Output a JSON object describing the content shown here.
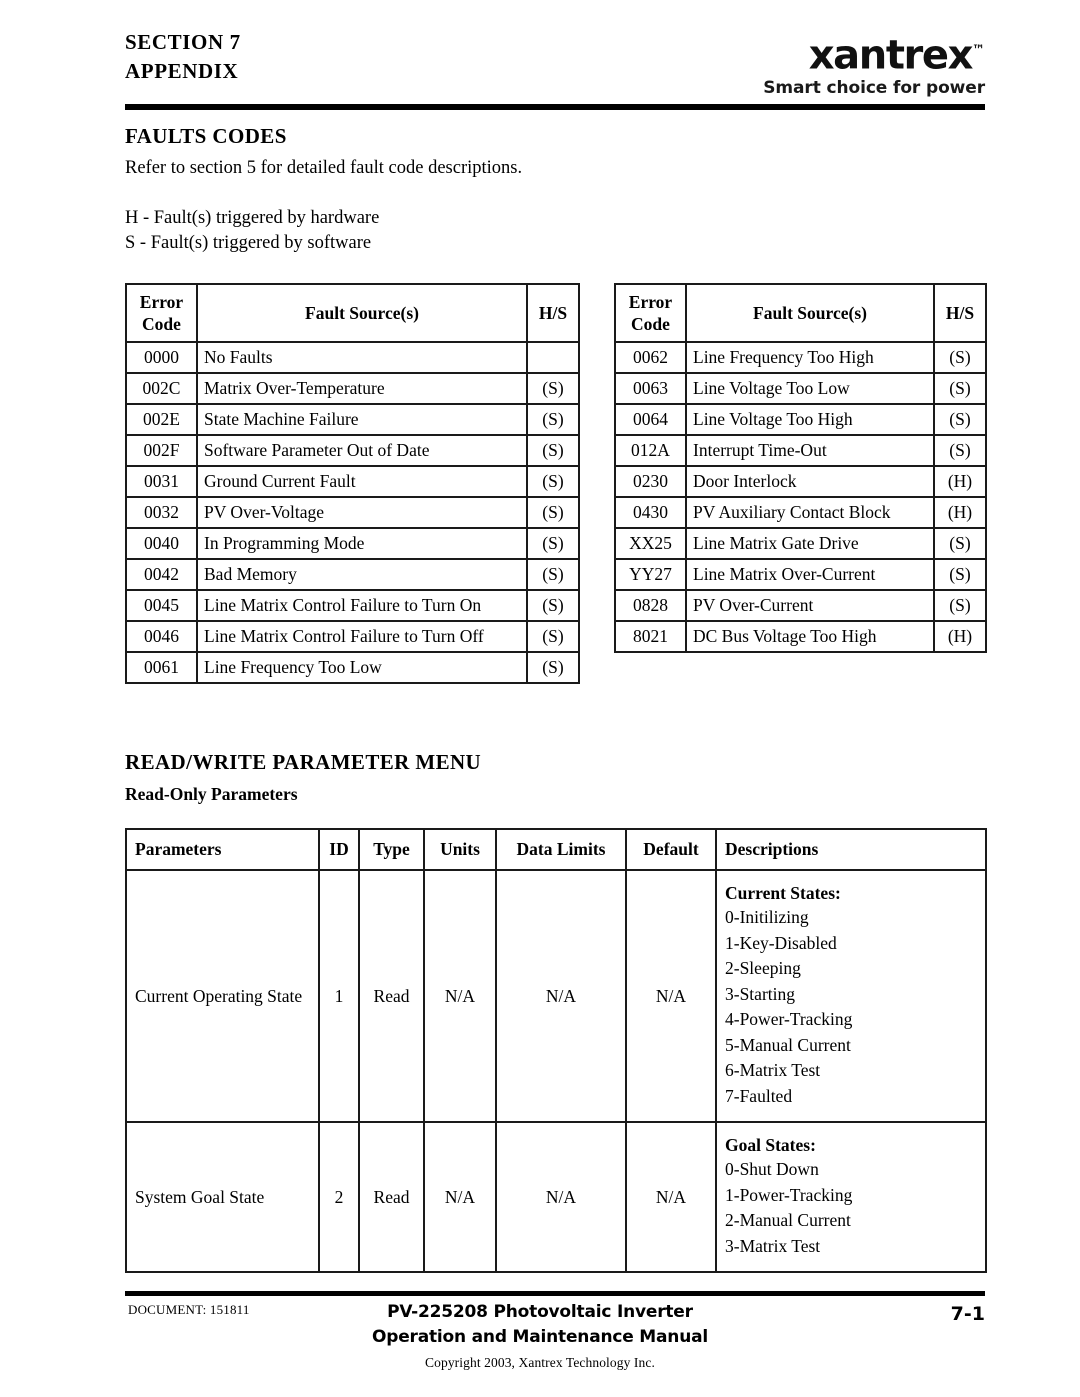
{
  "header": {
    "section_line1": "SECTION  7",
    "section_line2": "APPENDIX",
    "logo_text": "xantrex",
    "logo_tm": "™",
    "logo_tagline": "Smart choice for power"
  },
  "faults": {
    "heading": "FAULTS CODES",
    "intro": "Refer to section 5 for detailed fault code descriptions.",
    "legend_h": "H - Fault(s) triggered by hardware",
    "legend_s": "S - Fault(s) triggered by software",
    "columns": [
      "Error Code",
      "Fault Source(s)",
      "H/S"
    ],
    "col_code_line1": "Error",
    "col_code_line2": "Code",
    "col_source": "Fault Source(s)",
    "col_hs": "H/S",
    "left_rows": [
      {
        "code": "0000",
        "source": "No Faults",
        "hs": ""
      },
      {
        "code": "002C",
        "source": "Matrix Over-Temperature",
        "hs": "(S)"
      },
      {
        "code": "002E",
        "source": "State Machine Failure",
        "hs": "(S)"
      },
      {
        "code": "002F",
        "source": "Software Parameter Out of Date",
        "hs": "(S)"
      },
      {
        "code": "0031",
        "source": "Ground Current Fault",
        "hs": "(S)"
      },
      {
        "code": "0032",
        "source": "PV Over-Voltage",
        "hs": "(S)"
      },
      {
        "code": "0040",
        "source": "In Programming Mode",
        "hs": "(S)"
      },
      {
        "code": "0042",
        "source": "Bad Memory",
        "hs": "(S)"
      },
      {
        "code": "0045",
        "source": "Line Matrix Control Failure to Turn On",
        "hs": "(S)"
      },
      {
        "code": "0046",
        "source": "Line Matrix Control Failure to Turn Off",
        "hs": "(S)"
      },
      {
        "code": "0061",
        "source": "Line Frequency Too Low",
        "hs": "(S)"
      }
    ],
    "right_rows": [
      {
        "code": "0062",
        "source": "Line Frequency Too High",
        "hs": "(S)"
      },
      {
        "code": "0063",
        "source": "Line Voltage Too Low",
        "hs": "(S)"
      },
      {
        "code": "0064",
        "source": "Line Voltage Too High",
        "hs": "(S)"
      },
      {
        "code": "012A",
        "source": "Interrupt Time-Out",
        "hs": "(S)"
      },
      {
        "code": "0230",
        "source": "Door Interlock",
        "hs": "(H)"
      },
      {
        "code": "0430",
        "source": "PV Auxiliary Contact Block",
        "hs": "(H)"
      },
      {
        "code": "XX25",
        "source": "Line Matrix Gate Drive",
        "hs": "(S)"
      },
      {
        "code": "YY27",
        "source": "Line Matrix Over-Current",
        "hs": "(S)"
      },
      {
        "code": "0828",
        "source": "PV Over-Current",
        "hs": "(S)"
      },
      {
        "code": "8021",
        "source": "DC Bus Voltage Too High",
        "hs": "(H)"
      }
    ]
  },
  "parameters": {
    "heading": "READ/WRITE PARAMETER MENU",
    "subheading": "Read-Only Parameters",
    "columns": {
      "parameters": "Parameters",
      "id": "ID",
      "type": "Type",
      "units": "Units",
      "data_limits": "Data Limits",
      "default": "Default",
      "descriptions": "Descriptions"
    },
    "rows": [
      {
        "name": "Current Operating State",
        "id": "1",
        "type": "Read",
        "units": "N/A",
        "data_limits": "N/A",
        "default": "N/A",
        "desc_title": "Current States:",
        "desc_items": [
          "0-Initilizing",
          "1-Key-Disabled",
          "2-Sleeping",
          "3-Starting",
          "4-Power-Tracking",
          "5-Manual Current",
          "6-Matrix Test",
          "7-Faulted"
        ]
      },
      {
        "name": "System Goal State",
        "id": "2",
        "type": "Read",
        "units": "N/A",
        "data_limits": "N/A",
        "default": "N/A",
        "desc_title": "Goal States:",
        "desc_items": [
          "0-Shut Down",
          "1-Power-Tracking",
          "2-Manual Current",
          "3-Matrix Test"
        ]
      }
    ]
  },
  "footer": {
    "document": "DOCUMENT:  151811",
    "title_line1": "PV-225208 Photovoltaic Inverter",
    "title_line2": "Operation and Maintenance Manual",
    "copyright": "Copyright 2003, Xantrex Technology Inc.",
    "page_number": "7-1"
  }
}
